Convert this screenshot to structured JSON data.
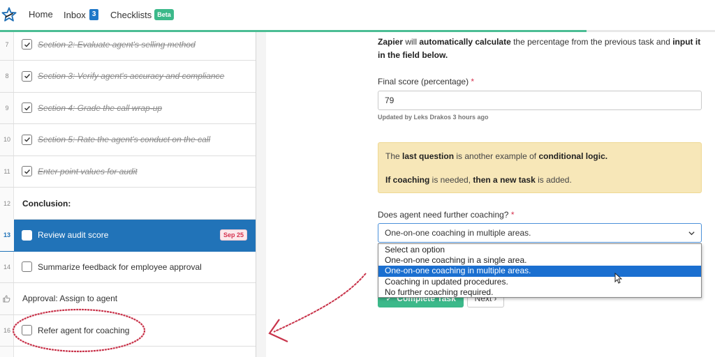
{
  "nav": {
    "logo_icon": "star-logo-icon",
    "items": [
      {
        "label": "Home"
      },
      {
        "label": "Inbox",
        "badge": "3"
      },
      {
        "label": "Checklists",
        "badge": "Beta"
      }
    ]
  },
  "progress": {
    "percent": 82,
    "color": "#4bbd94"
  },
  "tasks": [
    {
      "num": "7",
      "label": "Section 2: Evaluate agent's selling method",
      "state": "done"
    },
    {
      "num": "8",
      "label": "Section 3: Verify agent's accuracy and compliance",
      "state": "done"
    },
    {
      "num": "9",
      "label": "Section 4: Grade the call wrap-up",
      "state": "done"
    },
    {
      "num": "10",
      "label": "Section 5: Rate the agent's conduct on the call",
      "state": "done"
    },
    {
      "num": "11",
      "label": "Enter point values for audit",
      "state": "done"
    },
    {
      "num": "12",
      "label": "Conclusion:",
      "state": "heading"
    },
    {
      "num": "13",
      "label": "Review audit score",
      "state": "active",
      "due": "Sep 25"
    },
    {
      "num": "14",
      "label": "Summarize feedback for employee approval",
      "state": "open"
    },
    {
      "num": "",
      "icon": "thumbs-up-icon",
      "label": "Approval: Assign to agent",
      "state": "approval"
    },
    {
      "num": "16",
      "label": "Refer agent for coaching",
      "state": "open"
    }
  ],
  "content": {
    "intro": {
      "parts": [
        {
          "t": "Zapier",
          "b": true
        },
        {
          "t": " will ",
          "b": false
        },
        {
          "t": "automatically calculate",
          "b": true
        },
        {
          "t": " the percentage from the previous task and ",
          "b": false
        },
        {
          "t": "input it in the field below.",
          "b": true
        }
      ]
    },
    "final_score": {
      "label": "Final score (percentage)",
      "required_mark": "*",
      "value": "79",
      "updated_note": "Updated by Leks Drakos 3 hours ago"
    },
    "callout": {
      "line1": [
        {
          "t": "The ",
          "b": false
        },
        {
          "t": "last question",
          "b": true
        },
        {
          "t": " is another example of ",
          "b": false
        },
        {
          "t": "conditional logic.",
          "b": true
        }
      ],
      "line2": [
        {
          "t": "If coaching",
          "b": true
        },
        {
          "t": " is needed, ",
          "b": false
        },
        {
          "t": "then a new task",
          "b": true
        },
        {
          "t": " is added.",
          "b": false
        }
      ]
    },
    "coaching_question": {
      "label": "Does agent need further coaching?",
      "required_mark": "*",
      "selected": "One-on-one coaching in multiple areas.",
      "options": [
        "Select an option",
        "One-on-one coaching in a single area.",
        "One-on-one coaching in multiple areas.",
        "Coaching in updated procedures.",
        "No further coaching required."
      ],
      "selected_index": 2
    },
    "buttons": {
      "complete": "Complete Task",
      "next": "Next"
    }
  },
  "annotation_color": "#c8334a"
}
